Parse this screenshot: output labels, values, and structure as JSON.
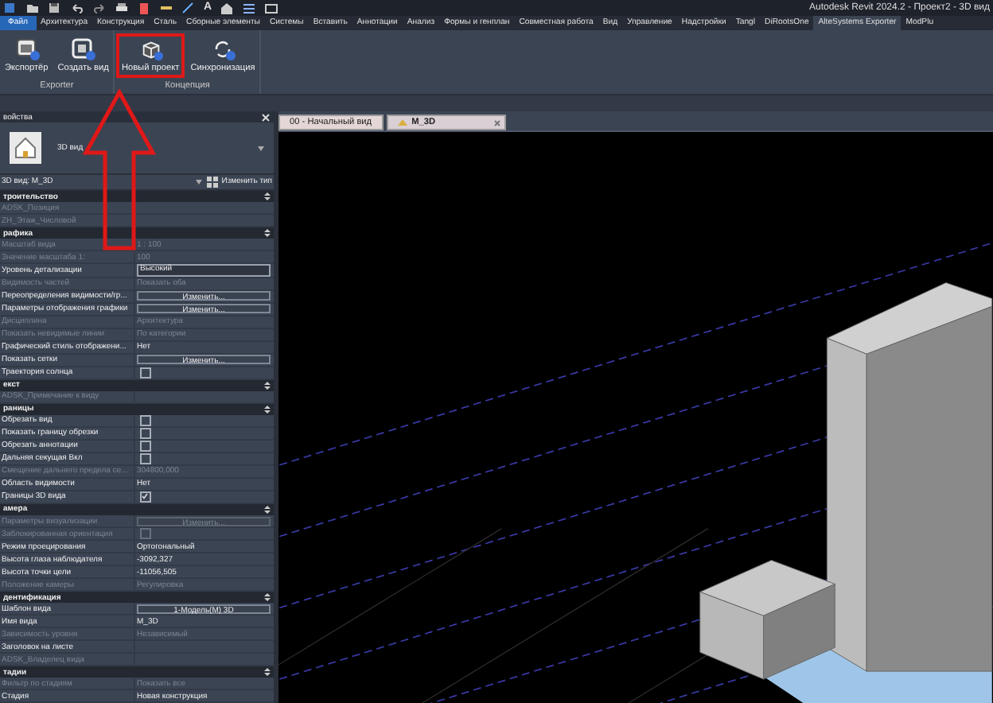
{
  "window": {
    "title": "Autodesk Revit 2024.2 - Проект2 - 3D вид",
    "text_tool_glyph": "A"
  },
  "ribbon_tabs": [
    {
      "label": "Файл",
      "selected": false,
      "kind": "file"
    },
    {
      "label": "Архитектура",
      "selected": false,
      "kind": "tab"
    },
    {
      "label": "Конструкция",
      "selected": false,
      "kind": "tab"
    },
    {
      "label": "Сталь",
      "selected": false,
      "kind": "tab"
    },
    {
      "label": "Сборные элементы",
      "selected": false,
      "kind": "tab"
    },
    {
      "label": "Системы",
      "selected": false,
      "kind": "tab"
    },
    {
      "label": "Вставить",
      "selected": false,
      "kind": "tab"
    },
    {
      "label": "Аннотации",
      "selected": false,
      "kind": "tab"
    },
    {
      "label": "Анализ",
      "selected": false,
      "kind": "tab"
    },
    {
      "label": "Формы и генплан",
      "selected": false,
      "kind": "tab"
    },
    {
      "label": "Совместная работа",
      "selected": false,
      "kind": "tab"
    },
    {
      "label": "Вид",
      "selected": false,
      "kind": "tab"
    },
    {
      "label": "Управление",
      "selected": false,
      "kind": "tab"
    },
    {
      "label": "Надстройки",
      "selected": false,
      "kind": "tab"
    },
    {
      "label": "Tangl",
      "selected": false,
      "kind": "tab"
    },
    {
      "label": "DiRootsOne",
      "selected": false,
      "kind": "tab"
    },
    {
      "label": "AlteSystems Exporter",
      "selected": true,
      "kind": "tab"
    },
    {
      "label": "ModPlu",
      "selected": false,
      "kind": "tab"
    }
  ],
  "ribbon_panels": [
    {
      "title": "Exporter",
      "buttons": [
        {
          "label": "Экспортёр",
          "highlighted": false,
          "kind": "export"
        },
        {
          "label": "Создать вид",
          "highlighted": false,
          "kind": "view"
        }
      ]
    },
    {
      "title": "Концепция",
      "buttons": [
        {
          "label": "Новый проект",
          "highlighted": true,
          "kind": "cube"
        },
        {
          "label": "Синхронизация",
          "highlighted": false,
          "kind": "sync"
        }
      ]
    }
  ],
  "properties": {
    "title": "войства",
    "type_name": "3D вид",
    "instance": "3D вид: M_3D",
    "edit_type": "Изменить тип",
    "sections": [
      {
        "title": "троительство",
        "rows": [
          {
            "label": "ADSK_Позиция",
            "kind": "text",
            "value": "",
            "disabled": true
          },
          {
            "label": "ZH_Этаж_Числовой",
            "kind": "text",
            "value": "",
            "disabled": true
          }
        ]
      },
      {
        "title": "рафика",
        "rows": [
          {
            "label": "Масштаб вида",
            "kind": "text",
            "value": "1 : 100",
            "disabled": true
          },
          {
            "label": "Значение масштаба    1:",
            "kind": "text",
            "value": "100",
            "disabled": true
          },
          {
            "label": "Уровень детализации",
            "kind": "field",
            "value": "Высокий",
            "disabled": false
          },
          {
            "label": "Видимость частей",
            "kind": "text",
            "value": "Показать оба",
            "disabled": true
          },
          {
            "label": "Переопределения видимости/гр...",
            "kind": "button",
            "value": "Изменить...",
            "disabled": false
          },
          {
            "label": "Параметры отображения графики",
            "kind": "button",
            "value": "Изменить...",
            "disabled": false
          },
          {
            "label": "Дисциплина",
            "kind": "text",
            "value": "Архитектура",
            "disabled": true
          },
          {
            "label": "Показать невидимые линии",
            "kind": "text",
            "value": "По категории",
            "disabled": true
          },
          {
            "label": "Графический стиль отображени...",
            "kind": "text",
            "value": "Нет",
            "disabled": false
          },
          {
            "label": "Показать сетки",
            "kind": "button",
            "value": "Изменить...",
            "disabled": false
          },
          {
            "label": "Траектория солнца",
            "kind": "checkbox",
            "checked": false,
            "disabled": false
          }
        ]
      },
      {
        "title": "екст",
        "rows": [
          {
            "label": "ADSK_Примечание к виду",
            "kind": "text",
            "value": "",
            "disabled": true
          }
        ]
      },
      {
        "title": "раницы",
        "rows": [
          {
            "label": "Обрезать вид",
            "kind": "checkbox",
            "checked": false,
            "disabled": false
          },
          {
            "label": "Показать границу обрезки",
            "kind": "checkbox",
            "checked": false,
            "disabled": false
          },
          {
            "label": "Обрезать аннотации",
            "kind": "checkbox",
            "checked": false,
            "disabled": false
          },
          {
            "label": "Дальняя секущая Вкл",
            "kind": "checkbox",
            "checked": false,
            "disabled": false
          },
          {
            "label": "Смещение дальнего предела се...",
            "kind": "text",
            "value": "304800,000",
            "disabled": true
          },
          {
            "label": "Область видимости",
            "kind": "text",
            "value": "Нет",
            "disabled": false
          },
          {
            "label": "Границы 3D вида",
            "kind": "checkbox",
            "checked": true,
            "disabled": false
          }
        ]
      },
      {
        "title": "амера",
        "rows": [
          {
            "label": "Параметры визуализации",
            "kind": "button",
            "value": "Изменить...",
            "disabled": true
          },
          {
            "label": "Заблокированная ориентация",
            "kind": "checkbox",
            "checked": false,
            "disabled": true
          },
          {
            "label": "Режим проецирования",
            "kind": "text",
            "value": "Ортогональный",
            "disabled": false
          },
          {
            "label": "Высота глаза наблюдателя",
            "kind": "text",
            "value": "-3092,327",
            "disabled": false
          },
          {
            "label": "Высота точки цели",
            "kind": "text",
            "value": "-11056,505",
            "disabled": false
          },
          {
            "label": "Положение камеры",
            "kind": "text",
            "value": "Регулировка",
            "disabled": true
          }
        ]
      },
      {
        "title": "дентификация",
        "rows": [
          {
            "label": "Шаблон вида",
            "kind": "button",
            "value": "1-Модель(M) 3D",
            "disabled": false
          },
          {
            "label": "Имя вида",
            "kind": "text",
            "value": "M_3D",
            "disabled": false
          },
          {
            "label": "Зависимость уровня",
            "kind": "text",
            "value": "Независимый",
            "disabled": true
          },
          {
            "label": "Заголовок на листе",
            "kind": "text",
            "value": "",
            "disabled": false
          },
          {
            "label": "ADSK_Владелец вида",
            "kind": "text",
            "value": "",
            "disabled": true
          }
        ]
      },
      {
        "title": "тадии",
        "rows": [
          {
            "label": "Фильтр по стадиям",
            "kind": "text",
            "value": "Показать все",
            "disabled": true
          },
          {
            "label": "Стадия",
            "kind": "text",
            "value": "Новая конструкция",
            "disabled": false
          }
        ]
      }
    ]
  },
  "view_tabs": [
    {
      "label": "00 - Начальный вид",
      "selected": false
    },
    {
      "label": "M_3D",
      "selected": true
    }
  ]
}
